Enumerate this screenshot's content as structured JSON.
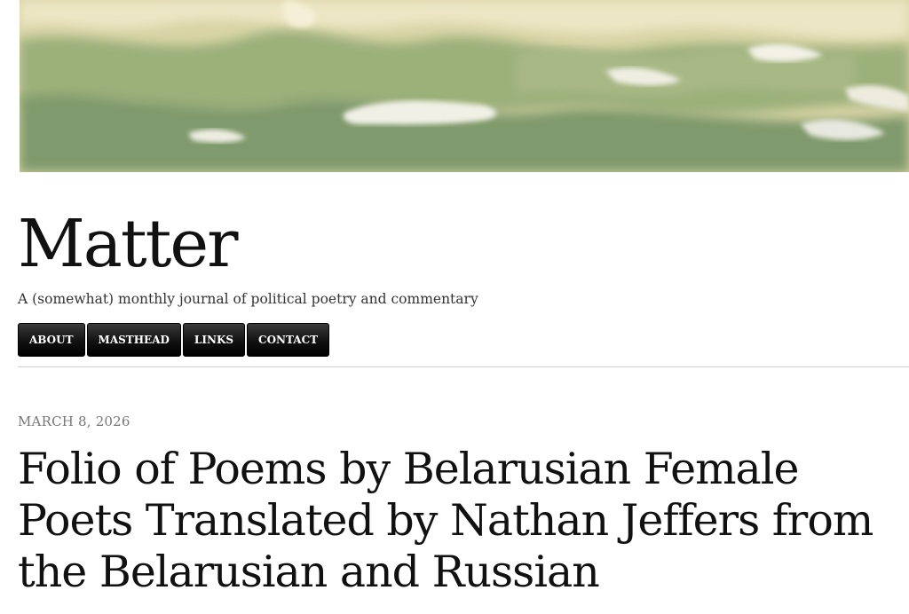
{
  "site": {
    "title": "Matter",
    "tagline": "A (somewhat) monthly journal of political poetry and commentary"
  },
  "nav": {
    "items": [
      {
        "label": "ABOUT"
      },
      {
        "label": "MASTHEAD"
      },
      {
        "label": "LINKS"
      },
      {
        "label": "CONTACT"
      }
    ]
  },
  "post": {
    "date": "MARCH 8, 2026",
    "title": "Folio of Poems by Belarusian Female Poets Translated by Nathan Jeffers from the Belarusian and Russian"
  },
  "colors": {
    "banner_light": "#e9e2bd",
    "banner_green": "#8ea372",
    "nav_button_bg": "#111111",
    "date_text": "#777777"
  }
}
